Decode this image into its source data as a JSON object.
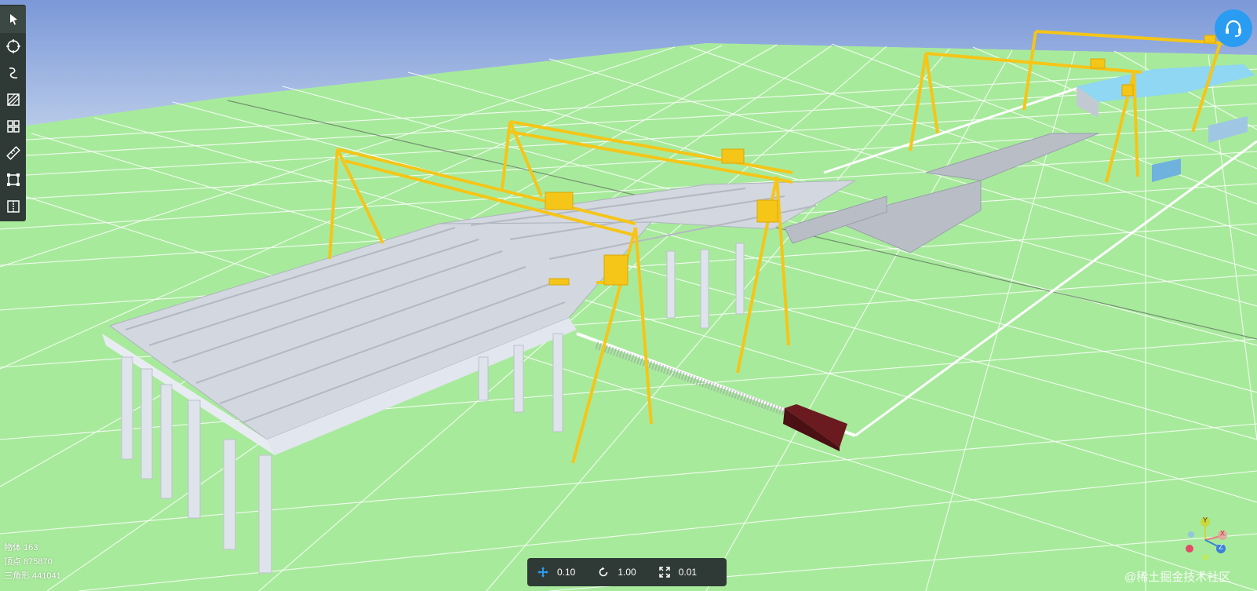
{
  "toolbar": {
    "tools": [
      {
        "name": "select",
        "icon": "arrow-pointer-icon"
      },
      {
        "name": "orbit",
        "icon": "circle-crosshair-icon"
      },
      {
        "name": "freehand",
        "icon": "curve-icon"
      },
      {
        "name": "section",
        "icon": "section-box-icon"
      },
      {
        "name": "grid",
        "icon": "grid-icon"
      },
      {
        "name": "measure",
        "icon": "ruler-icon"
      },
      {
        "name": "frame",
        "icon": "frame-select-icon"
      },
      {
        "name": "split",
        "icon": "split-view-icon"
      }
    ]
  },
  "stats": {
    "objects": "物体 163",
    "vertices": "顶点 875870",
    "triangles": "三角形 441041"
  },
  "controls": {
    "move_speed": "0.10",
    "rotate_speed": "1.00",
    "zoom_speed": "0.01"
  },
  "axes": {
    "y": "Y",
    "x": "X",
    "z": "Z"
  },
  "watermark": "@稀土掘金技术社区",
  "colors": {
    "sky_top": "#7b98d8",
    "ground": "#a8ea9c",
    "crane": "#f5c518",
    "girder": "#cfd4de",
    "accent": "#2a9cf2",
    "panel": "#2f3a36"
  }
}
